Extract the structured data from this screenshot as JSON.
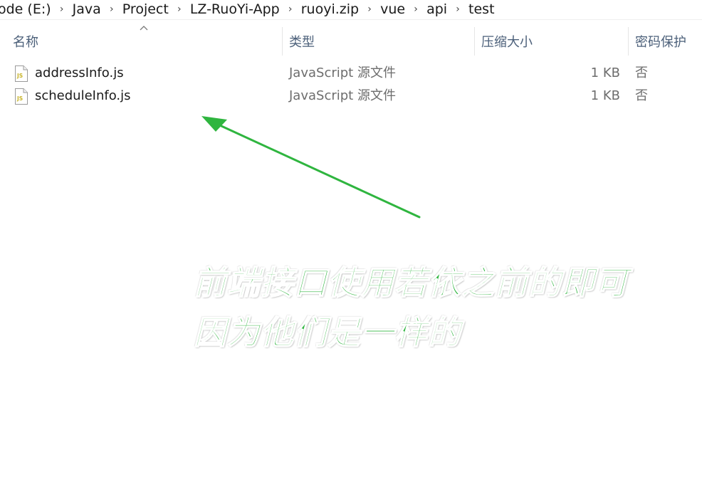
{
  "breadcrumb": {
    "items": [
      "ode (E:)",
      "Java",
      "Project",
      "LZ-RuoYi-App",
      "ruoyi.zip",
      "vue",
      "api",
      "test"
    ],
    "separator": "›"
  },
  "columns": {
    "name": "名称",
    "type": "类型",
    "compressed_size": "压缩大小",
    "password": "密码保护"
  },
  "files": [
    {
      "name": "addressInfo.js",
      "type": "JavaScript 源文件",
      "size": "1 KB",
      "password": "否",
      "icon": "js-file-icon"
    },
    {
      "name": "scheduleInfo.js",
      "type": "JavaScript 源文件",
      "size": "1 KB",
      "password": "否",
      "icon": "js-file-icon"
    }
  ],
  "annotation": {
    "lines": [
      "前端接口使用若依之前的即可",
      "因为他们是一样的"
    ],
    "color": "#2fb53f"
  },
  "colors": {
    "header_text": "#4c607a",
    "secondary_text": "#6d6d6d",
    "primary_text": "#1a1a1a",
    "annotation_green": "#2fb53f"
  }
}
